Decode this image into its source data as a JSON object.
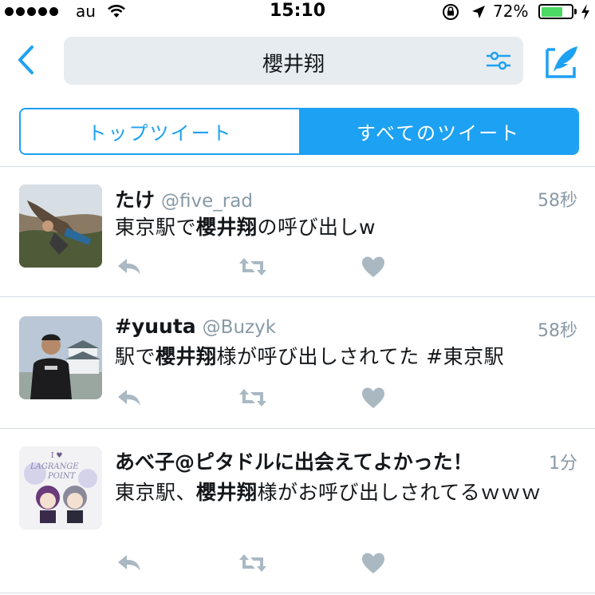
{
  "status_bar": {
    "carrier": "au",
    "time": "15:10",
    "battery": "72%",
    "battery_level": 0.72,
    "icons": [
      "signal-dots",
      "wifi-icon",
      "rotation-lock-icon",
      "location-arrow-icon",
      "battery-icon",
      "charging-bolt-icon"
    ]
  },
  "nav": {
    "back_icon": "chevron-left-icon",
    "search_query": "櫻井翔",
    "filter_icon": "sliders-icon",
    "compose_icon": "compose-quill-icon"
  },
  "tabs": [
    {
      "label": "トップツイート",
      "selected": false
    },
    {
      "label": "すべてのツイート",
      "selected": true
    }
  ],
  "colors": {
    "accent": "#1da1f2",
    "icon_gray": "#aab8c2",
    "secondary_text": "#8899a6",
    "search_bg": "#e6ecf0"
  },
  "tweets": [
    {
      "name": "たけ",
      "handle": "@five_rad",
      "time": "58秒",
      "text_before": "東京駅で",
      "text_bold": "櫻井翔",
      "text_after": "の呼び出しw"
    },
    {
      "name": "#yuuta",
      "handle": "@Buzyk",
      "time": "58秒",
      "text_before": "駅で",
      "text_bold": "櫻井翔",
      "text_after": "様が呼び出しされてた #東京駅"
    },
    {
      "name": "あべ子@ピタドルに出会えてよかった！",
      "handle": "",
      "time": "1分",
      "text_before": "東京駅、",
      "text_bold": "櫻井翔",
      "text_after": "様がお呼び出しされてるｗｗｗ",
      "avatar_text_top": "I ♥",
      "avatar_text_mid": "LAGRANGE",
      "avatar_text_bot": "POINT"
    }
  ],
  "actions": {
    "reply_icon": "reply-icon",
    "retweet_icon": "retweet-icon",
    "like_icon": "heart-icon"
  }
}
